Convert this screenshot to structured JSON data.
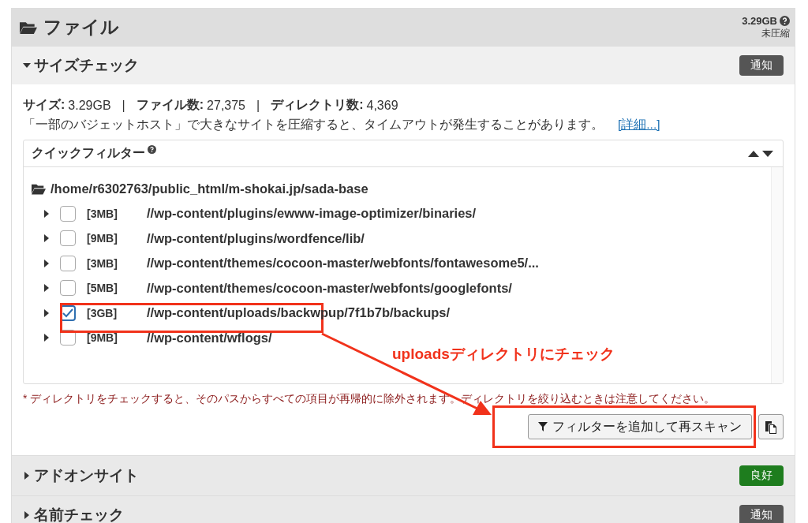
{
  "header": {
    "title": "ファイル",
    "size": "3.29GB",
    "size_note": "未圧縮"
  },
  "size_check": {
    "title": "サイズチェック",
    "expanded": true,
    "separator": "|",
    "badge": {
      "label": "通知",
      "color": "#555555"
    },
    "stats": [
      {
        "label": "サイズ:",
        "value": "3.29GB"
      },
      {
        "label": "ファイル数:",
        "value": "27,375"
      },
      {
        "label": "ディレクトリ数:",
        "value": "4,369"
      }
    ],
    "warning": "「一部のバジェットホスト」で大きなサイトを圧縮すると、タイムアウトが発生することがあります。",
    "link": "[詳細...]",
    "quick_filter": {
      "title": "クイックフィルター",
      "root": "/home/r6302763/public_html/m-shokai.jp/sada-base",
      "rows": [
        {
          "size": "[3MB]",
          "path": "//wp-content/plugins/ewww-image-optimizer/binaries/",
          "checked": false
        },
        {
          "size": "[9MB]",
          "path": "//wp-content/plugins/wordfence/lib/",
          "checked": false
        },
        {
          "size": "[3MB]",
          "path": "//wp-content/themes/cocoon-master/webfonts/fontawesome5/...",
          "checked": false
        },
        {
          "size": "[5MB]",
          "path": "//wp-content/themes/cocoon-master/webfonts/googlefonts/",
          "checked": false
        },
        {
          "size": "[3GB]",
          "path": "//wp-content/uploads/backwpup/7f1b7b/backups/",
          "checked": true
        },
        {
          "size": "[9MB]",
          "path": "//wp-content/wflogs/",
          "checked": false
        }
      ]
    },
    "note": "* ディレクトリをチェックすると、そのパスからすべての項目が再帰的に除外されます。ディレクトリを絞り込むときは注意してください。",
    "button": "フィルターを追加して再スキャン"
  },
  "sections": [
    {
      "title": "アドオンサイト",
      "expanded": false,
      "badge": {
        "label": "良好",
        "color": "#1e7d1e"
      }
    },
    {
      "title": "名前チェック",
      "expanded": false,
      "badge": {
        "label": "通知",
        "color": "#555555"
      }
    }
  ],
  "annotation": {
    "text": "uploadsディレクトリにチェック"
  }
}
